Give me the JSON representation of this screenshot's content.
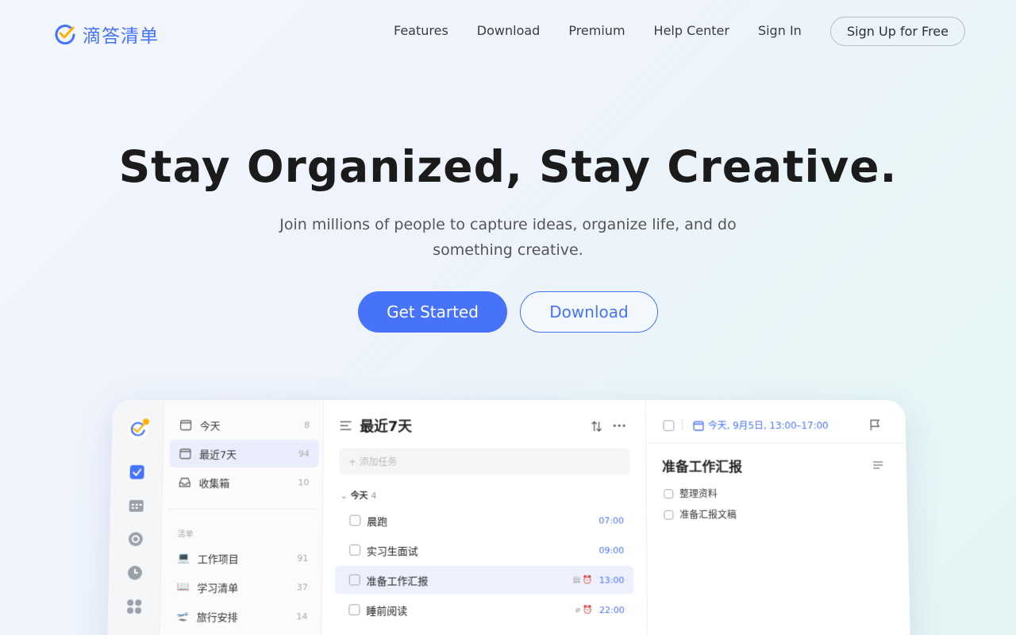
{
  "brand": {
    "name": "滴答清单",
    "accent": "#4772fa"
  },
  "nav": {
    "links": [
      "Features",
      "Download",
      "Premium",
      "Help Center",
      "Sign In"
    ],
    "signup_label": "Sign Up for Free"
  },
  "hero": {
    "title": "Stay Organized, Stay Creative.",
    "subtitle": "Join millions of people to capture ideas, organize life, and do something creative.",
    "primary_label": "Get Started",
    "secondary_label": "Download"
  },
  "app": {
    "smart_lists": [
      {
        "icon": "calendar-today-icon",
        "label": "今天",
        "count": "8"
      },
      {
        "icon": "calendar-week-icon",
        "label": "最近7天",
        "count": "94"
      },
      {
        "icon": "inbox-icon",
        "label": "收集箱",
        "count": "10"
      }
    ],
    "lists_section_label": "清单",
    "lists": [
      {
        "icon": "💻",
        "label": "工作项目",
        "count": "91"
      },
      {
        "icon": "📖",
        "label": "学习清单",
        "count": "37"
      },
      {
        "icon": "🛫",
        "label": "旅行安排",
        "count": "14"
      }
    ],
    "tasks_title": "最近7天",
    "add_task_placeholder": "+ 添加任务",
    "group_label": "今天",
    "group_count": "4",
    "tasks": [
      {
        "label": "晨跑",
        "time": "07:00"
      },
      {
        "label": "实习生面试",
        "time": "09:00"
      },
      {
        "label": "准备工作汇报",
        "time": "13:00"
      },
      {
        "label": "睡前阅读",
        "time": "22:00"
      }
    ],
    "detail": {
      "date": "今天, 9月5日, 13:00–17:00",
      "title": "准备工作汇报",
      "subtasks": [
        "整理资料",
        "准备汇报文稿"
      ]
    }
  }
}
